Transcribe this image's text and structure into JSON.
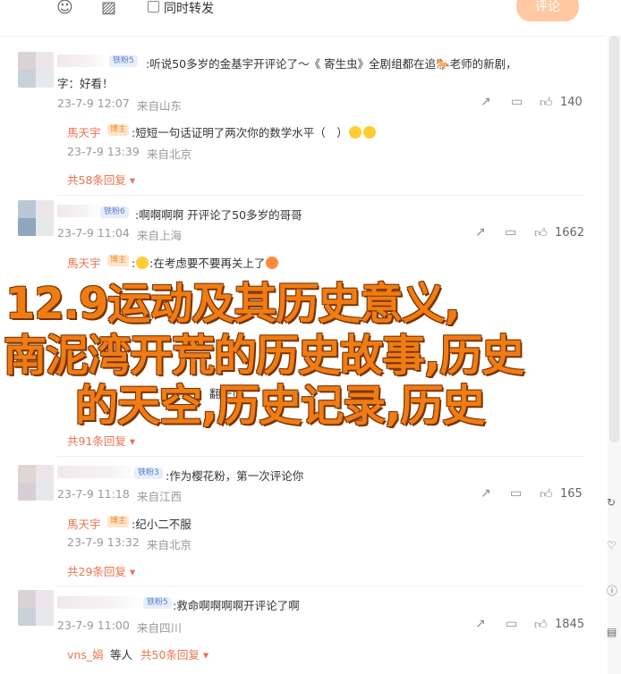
{
  "toolbar": {
    "emoji_icon": "smile-icon",
    "image_icon": "image-icon",
    "forward_label": "同时转发",
    "post_button": "评论"
  },
  "comments": [
    {
      "badge": "铁粉5",
      "text": ":听说50多岁的金基宇开评论了～《 寄生虫》全剧组都在追🐎老师的新剧，",
      "text2": "字：好看！",
      "time": "23-7-9 12:07",
      "location": "来自山东",
      "likes": "140",
      "reply": {
        "user": "馬天宇",
        "badge": "博主",
        "text": ":短短一句话证明了两次你的数学水平（　）",
        "time": "23-7-9 13:39",
        "location": "来自北京"
      },
      "more": "共58条回复"
    },
    {
      "badge": "铁粉6",
      "text": ":啊啊啊啊 开评论了50多岁的哥哥",
      "time": "23-7-9 11:04",
      "location": "来自上海",
      "likes": "1662",
      "reply": {
        "user": "馬天宇",
        "badge": "博主",
        "text": ":在考虑要不要再关上了"
      },
      "reply2": {
        "text_tail": "翻一页"
      },
      "more": "共91条回复"
    },
    {
      "badge": "铁粉3",
      "text": ":作为樱花粉，第一次评论你",
      "time": "23-7-9 11:18",
      "location": "来自江西",
      "likes": "165",
      "reply": {
        "user": "馬天宇",
        "badge": "博主",
        "text": ":纪小二不服",
        "time": "23-7-9 13:32",
        "location": "来自北京"
      },
      "more": "共29条回复"
    },
    {
      "badge": "铁粉5",
      "text": ":救命啊啊啊啊开评论了啊",
      "time": "23-7-9 11:00",
      "location": "来自四川",
      "likes": "1845",
      "footer_user": "vns_娟",
      "footer_mid": "等人",
      "more": "共50条回复"
    }
  ],
  "overlay": {
    "line1": "12.9运动及其历史意义,",
    "line2": "南泥湾开荒的历史故事,历史",
    "line3": "的天空,历史记录,历史"
  },
  "colors": {
    "accent": "#eb7350",
    "overlay_text": "#f07c14",
    "badge_blue": "#5b7fc4"
  }
}
